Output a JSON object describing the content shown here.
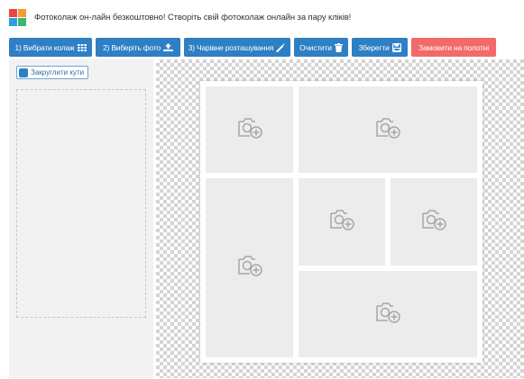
{
  "header": {
    "text": "Фотоколаж он-лайн безкоштовно! Створіть свій фотоколаж онлайн за пару кліків!",
    "logo_colors": [
      "#e8463f",
      "#f39c34",
      "#2e9fd8",
      "#3fb56b"
    ]
  },
  "toolbar": {
    "buttons": [
      {
        "label": "1) Вибрати колаж",
        "icon": "grid-icon",
        "color": "#2e7fc4"
      },
      {
        "label": "2) Виберіть фото",
        "icon": "upload-icon",
        "color": "#2e7fc4"
      },
      {
        "label": "3) Чарівне розташування",
        "icon": "magic-wand-icon",
        "color": "#2e7fc4"
      },
      {
        "label": "Очистити",
        "icon": "trash-icon",
        "color": "#2e7fc4"
      },
      {
        "label": "Зберегти",
        "icon": "save-icon",
        "color": "#2e7fc4"
      },
      {
        "label": "Замовити на полотні",
        "icon": "",
        "color": "#f26a6a"
      }
    ]
  },
  "sidebar": {
    "round_corners_label": "Закруглити кути",
    "round_corners_checked": true
  },
  "collage": {
    "cell_icon": "add-photo-icon",
    "cell_count": 6
  }
}
